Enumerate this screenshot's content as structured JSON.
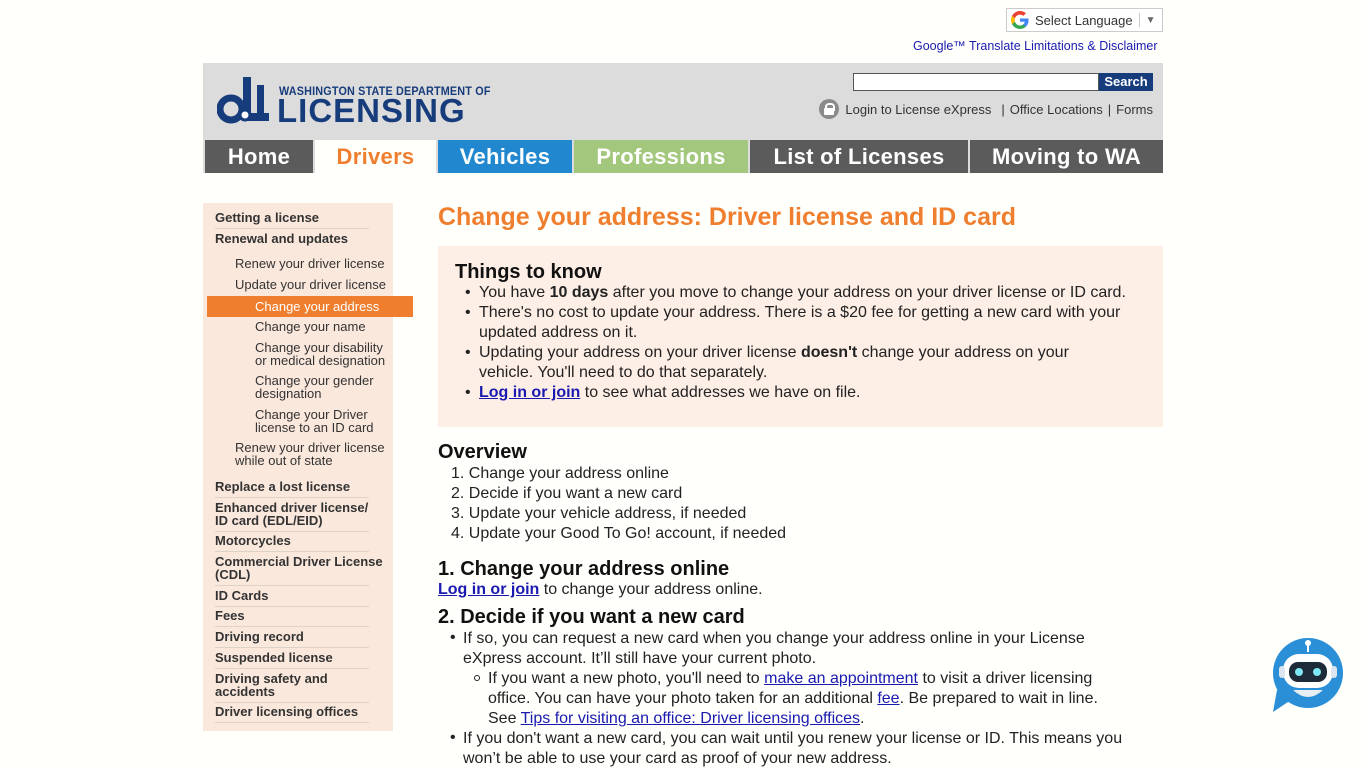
{
  "translate": {
    "select_language": "Select Language",
    "disclaimer": "Google™ Translate Limitations & Disclaimer"
  },
  "header": {
    "dept": "WASHINGTON STATE DEPARTMENT OF",
    "licensing": "LICENSING",
    "search_button": "Search",
    "login": "Login to License eXpress",
    "office_locations": "Office Locations",
    "forms": "Forms",
    "pipe": "|"
  },
  "nav": {
    "home": "Home",
    "drivers": "Drivers",
    "vehicles": "Vehicles",
    "professions": "Professions",
    "list_of_licenses": "List of Licenses",
    "moving": "Moving to WA"
  },
  "colors": {
    "orange": "#ef7e2e",
    "navy": "#173c7c",
    "tab_gray": "#5b5b5b",
    "tab_blue": "#2188d0",
    "tab_green": "#a3c77c"
  },
  "sidebar": {
    "getting": "Getting a license",
    "renewal": "Renewal and updates",
    "renew": "Renew your driver license",
    "update": "Update your driver license",
    "change_address": "Change your address",
    "change_name": "Change your name",
    "disability_1": "Change your disability",
    "disability_2": "or medical designation",
    "gender_1": "Change your gender",
    "gender_2": "designation",
    "idcard_1": "Change your Driver",
    "idcard_2": "license to an ID card",
    "outstate_1": "Renew your driver license",
    "outstate_2": "while out of state",
    "replace": "Replace a lost license",
    "edl_1": "Enhanced driver license/",
    "edl_2": "ID card (EDL/EID)",
    "motorcycles": "Motorcycles",
    "cdl_1": "Commercial Driver License",
    "cdl_2": "(CDL)",
    "idcards": "ID Cards",
    "fees": "Fees",
    "record": "Driving record",
    "suspended": "Suspended license",
    "safety_1": "Driving safety and",
    "safety_2": "accidents",
    "offices": "Driver licensing offices"
  },
  "main": {
    "title": "Change your address: Driver license and ID card",
    "things_title": "Things to know",
    "k1_a": "You have ",
    "k1_b": "10 days",
    "k1_c": " after you move to change your address on your driver license or ID card.",
    "k2_a": "There's no cost to update your address. There is a $20 fee for getting a new card with your",
    "k2_b": "updated address on it.",
    "k3_a": "Updating your address on your driver license ",
    "k3_b": "doesn't",
    "k3_c": " change your address on your",
    "k3_d": "vehicle. You'll need to do that separately.",
    "k4_link": "Log in or join",
    "k4_rest": " to see what addresses we have on file.",
    "overview": "Overview",
    "o1": "1. Change your address online",
    "o2": "2. Decide if you want a new card",
    "o3": "3. Update your vehicle address, if needed",
    "o4": "4. Update your Good To Go! account, if needed",
    "step1_title": "1. Change your address online",
    "step1_link": "Log in or join",
    "step1_rest": " to change your address online.",
    "step2_title": "2. Decide if you want a new card",
    "s2_a1": "If so, you can request a new card when you change your address online in your License",
    "s2_a2": "eXpress account. It’ll still have your current photo.",
    "s2_b1_pre": "If you want a new photo, you'll need to ",
    "s2_b1_link": "make an appointment",
    "s2_b1_post": " to visit a driver licensing",
    "s2_b2_pre": "office. You can have your photo taken for an additional ",
    "s2_b2_link": "fee",
    "s2_b2_post": ". Be prepared to wait in line.",
    "s2_b3_pre": "See ",
    "s2_b3_link": "Tips for visiting an office: Driver licensing offices",
    "s2_b3_post": ".",
    "s2_c1": "If you don't want a new card, you can wait until you renew your license or ID. This means you",
    "s2_c2": "won’t be able to use your card as proof of your new address."
  }
}
